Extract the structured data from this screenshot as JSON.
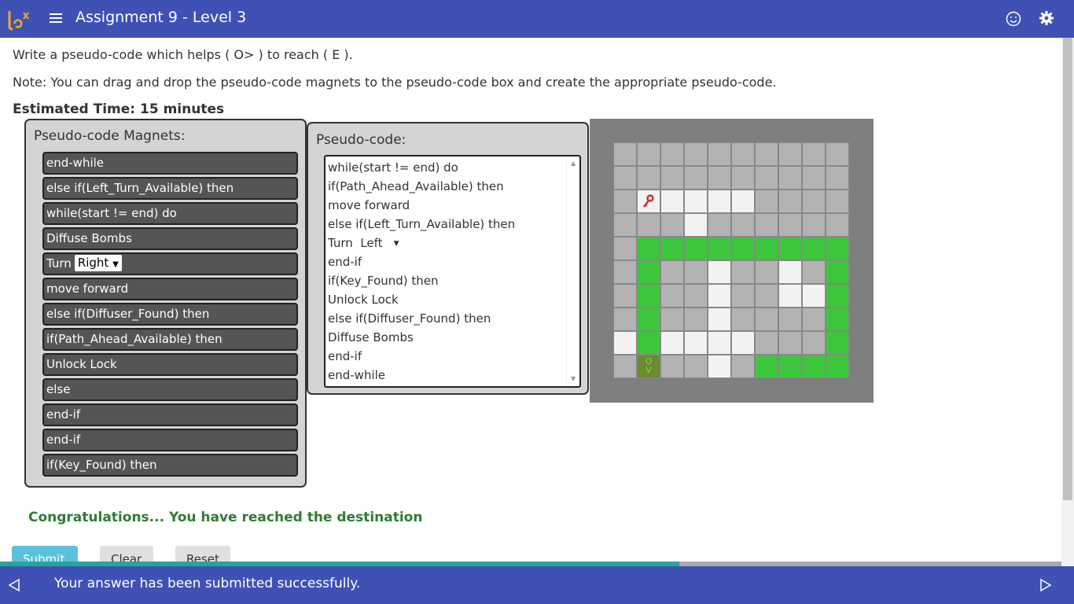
{
  "header": {
    "title": "Assignment 9 - Level 3"
  },
  "instructions": {
    "line1": "Write a pseudo-code which helps ( O> ) to reach ( E ).",
    "line2": "Note: You can drag and drop the pseudo-code magnets to the pseudo-code box and create the appropriate pseudo-code.",
    "estimated_time": "Estimated Time: 15 minutes"
  },
  "magnets": {
    "title": "Pseudo-code Magnets:",
    "items": [
      "end-while",
      "else if(Left_Turn_Available) then",
      "while(start != end) do",
      "Diffuse Bombs",
      "Turn",
      "move forward",
      "else if(Diffuser_Found) then",
      "if(Path_Ahead_Available) then",
      "Unlock Lock",
      "else",
      "end-if",
      "end-if",
      "if(Key_Found) then"
    ],
    "turn_select_value": "Right"
  },
  "pseudocode": {
    "title": "Pseudo-code:",
    "lines": [
      "while(start != end) do",
      "if(Path_Ahead_Available) then",
      "move forward",
      "else if(Left_Turn_Available) then",
      "Turn  Left",
      "end-if",
      "if(Key_Found) then",
      "Unlock Lock",
      "else if(Diffuser_Found) then",
      "Diffuse Bombs",
      "end-if",
      "end-while"
    ]
  },
  "maze": {
    "rows": [
      "GGGGGGGGGGG",
      "GGGGGGGGGGG",
      "GKWWWWGGGGG",
      "GGGWGGGGGGG",
      "GPPPPPPPPPP",
      "GPGGWGGWGP",
      "GPGGWGGWWP",
      "GPGGWGGGGP",
      "WPWWWWGGGP",
      "GEGGWGPPPP"
    ],
    "colors": {
      "G": "#b3b3b3",
      "W": "#f2f2f2",
      "P": "#3cc63c",
      "E": "#6a8a33",
      "K": "#f2f2f2"
    },
    "end_marker": "O",
    "end_marker2": "V"
  },
  "status": {
    "congrats": "Congratulations... You have reached the destination"
  },
  "buttons": {
    "submit": "Submit",
    "clear": "Clear",
    "reset": "Reset"
  },
  "progress": {
    "fraction": 0.64
  },
  "footer": {
    "message": "Your answer has been submitted successfully."
  }
}
